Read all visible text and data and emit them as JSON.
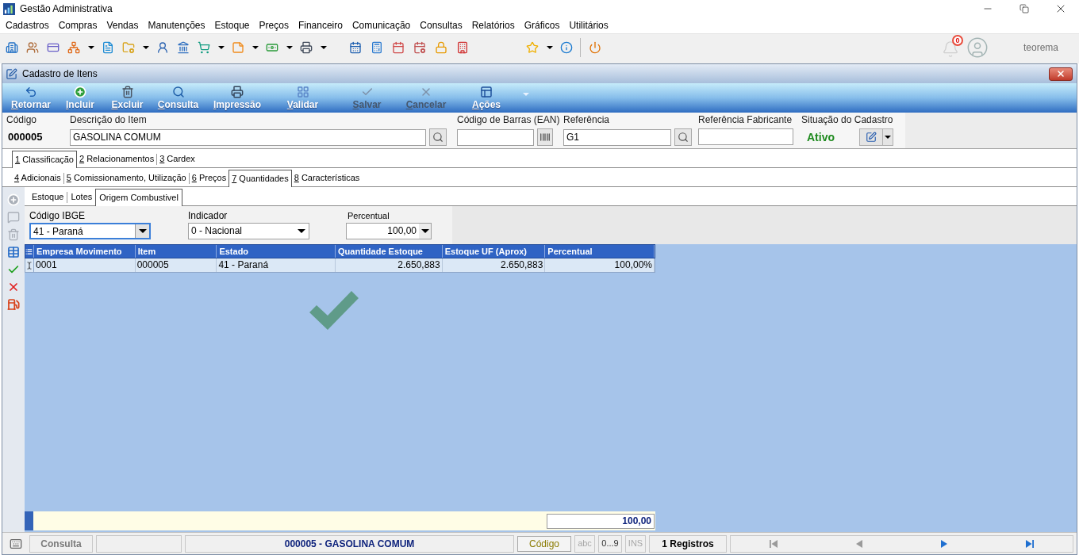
{
  "app": {
    "title": "Gestão Administrativa",
    "menu": [
      "Cadastros",
      "Compras",
      "Vendas",
      "Manutenções",
      "Estoque",
      "Preços",
      "Financeiro",
      "Comunicação",
      "Consultas",
      "Relatórios",
      "Gráficos",
      "Utilitários"
    ],
    "notifications": "0",
    "user": "teorema"
  },
  "window": {
    "title": "Cadastro de Itens"
  },
  "actions": [
    {
      "kind": "back",
      "label": "Retornar",
      "disabled": false
    },
    {
      "kind": "add",
      "label": "Incluir",
      "disabled": false
    },
    {
      "kind": "delete",
      "label": "Excluir",
      "disabled": false
    },
    {
      "kind": "search",
      "label": "Consulta",
      "disabled": false
    },
    {
      "kind": "print",
      "label": "Impressão",
      "disabled": false
    },
    {
      "kind": "validate",
      "label": "Validar",
      "disabled": false
    },
    {
      "kind": "save",
      "label": "Salvar",
      "disabled": true
    },
    {
      "kind": "cancel",
      "label": "Cancelar",
      "disabled": true
    },
    {
      "kind": "menu",
      "label": "Ações",
      "disabled": false
    }
  ],
  "fields": [
    {
      "kind": "code",
      "label": "Código",
      "value": "000005"
    },
    {
      "kind": "text",
      "label": "Descrição do Item",
      "value": "GASOLINA COMUM",
      "button": {
        "kind": "search"
      }
    },
    {
      "kind": "text",
      "label": "Código de Barras (EAN)",
      "button": {
        "kind": "barcode"
      }
    },
    {
      "kind": "text",
      "label": "Referência",
      "value": "G1",
      "button": {
        "kind": "search"
      }
    },
    {
      "kind": "text",
      "label": "Referência Fabricante"
    },
    {
      "kind": "status",
      "label": "Situação do Cadastro",
      "value": "Ativo",
      "active": true
    }
  ],
  "tab_rows": [
    {
      "tabs": [
        {
          "label": "1 Classificação",
          "selected": true
        },
        {
          "label": "2 Relacionamentos",
          "selected": false
        },
        {
          "label": "3 Cardex",
          "selected": false
        }
      ]
    },
    {
      "tabs": [
        {
          "label": "4 Adicionais",
          "selected": false
        },
        {
          "label": "5 Comissionamento, Utilização",
          "selected": false
        },
        {
          "label": "6 Preços",
          "selected": false
        },
        {
          "label": "7 Quantidades",
          "selected": true
        },
        {
          "label": "8 Características",
          "selected": false
        }
      ]
    }
  ],
  "subtabs": [
    {
      "label": "Estoque",
      "selected": false
    },
    {
      "label": "Lotes",
      "selected": false
    },
    {
      "label": "Origem Combustivel",
      "selected": true
    }
  ],
  "side_tools": [
    {
      "kind": "add",
      "disabled": true
    },
    {
      "kind": "comment",
      "disabled": true
    },
    {
      "kind": "delete",
      "disabled": true
    },
    {
      "kind": "grid",
      "disabled": false
    },
    {
      "kind": "confirm",
      "disabled": false
    },
    {
      "kind": "cancel",
      "disabled": false
    },
    {
      "kind": "fuel",
      "disabled": false
    }
  ],
  "filters": [
    {
      "kind": "list",
      "label": "Código IBGE",
      "value": "41 - Paraná",
      "focused": true
    },
    {
      "kind": "list",
      "label": "Indicador",
      "value": "0 - Nacional",
      "focused": false
    },
    {
      "kind": "number",
      "label": "Percentual",
      "value": "100,00",
      "focused": false
    }
  ],
  "table": {
    "columns": [
      "Empresa Movimento",
      "Item",
      "Estado",
      "Quantidade Estoque",
      "Estoque UF (Aprox)",
      "Percentual"
    ],
    "rows": [
      {
        "selected": true,
        "cells": [
          "0001",
          "000005",
          "41 - Paraná",
          "2.650,883",
          "2.650,883",
          "100,00%"
        ]
      }
    ],
    "total": "100,00"
  },
  "status_bar": {
    "mode": "Consulta",
    "record": "000005 - GASOLINA COMUM",
    "sort_key": "Código",
    "indicators": [
      {
        "label": "abc",
        "on": false
      },
      {
        "label": "0...9",
        "on": true
      },
      {
        "label": "INS",
        "on": false
      }
    ],
    "count": "1 Registros",
    "nav": [
      {
        "kind": "first",
        "disabled": true
      },
      {
        "kind": "previous",
        "disabled": true
      },
      {
        "kind": "next",
        "disabled": false
      },
      {
        "kind": "last",
        "disabled": false
      }
    ]
  }
}
